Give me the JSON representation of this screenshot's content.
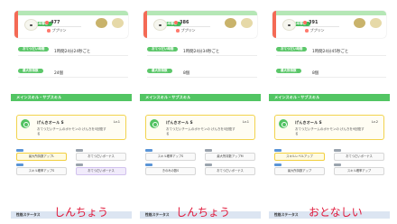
{
  "panels": [
    {
      "header_tag": "基本情報",
      "hp": "477",
      "owner": "ププリン",
      "rows": [
        {
          "label": "おてつだい時間",
          "value": "1時間24分24秒ごと"
        },
        {
          "label": "最大所持数",
          "value": "24個"
        }
      ],
      "section": "メインスキル・サブスキル",
      "skill_name": "げんきオール S",
      "skill_level": "Lv.1",
      "skill_desc": "おてつだいチームのポケモンの げんきを5回復する",
      "sub_skills": [
        {
          "label": "最大所持数アップL",
          "style": "gold",
          "chip": "blue"
        },
        {
          "label": "おてつだいボーナス",
          "style": "plain",
          "chip": "grey"
        },
        {
          "label": "スキル確率アップS",
          "style": "plain",
          "chip": "blue"
        },
        {
          "label": "おてつだいボーナス",
          "style": "lilac",
          "chip": "grey"
        }
      ],
      "footer": "性格ステータス",
      "caption": "しんちょう"
    },
    {
      "header_tag": "基本情報",
      "hp": "386",
      "owner": "ププリン",
      "rows": [
        {
          "label": "おてつだい時間",
          "value": "1時間24分34秒ごと"
        },
        {
          "label": "最大所持数",
          "value": "8個"
        }
      ],
      "section": "メインスキル・サブスキル",
      "skill_name": "げんきオール S",
      "skill_level": "Lv.1",
      "skill_desc": "おてつだいチームのポケモンの げんきを5回復する",
      "sub_skills": [
        {
          "label": "スキル確率アップS",
          "style": "plain",
          "chip": "blue"
        },
        {
          "label": "最大所持数アップM",
          "style": "plain",
          "chip": "grey"
        },
        {
          "label": "きのみの数S",
          "style": "plain",
          "chip": "blue"
        },
        {
          "label": "おてつだいボーナス",
          "style": "plain",
          "chip": "grey"
        }
      ],
      "footer": "性格ステータス",
      "caption": "しんちょう"
    },
    {
      "header_tag": "基本情報",
      "hp": "391",
      "owner": "ププリン",
      "rows": [
        {
          "label": "おてつだい時間",
          "value": "1時間24分45秒ごと"
        },
        {
          "label": "最大所持数",
          "value": "8個"
        }
      ],
      "section": "メインスキル・サブスキル",
      "skill_name": "げんきオール S",
      "skill_level": "Lv.2",
      "skill_desc": "おてつだいチームのポケモンの げんきを9回復する",
      "sub_skills": [
        {
          "label": "スキルレベルアップ",
          "style": "gold",
          "chip": "blue"
        },
        {
          "label": "おてつだいボーナス",
          "style": "plain",
          "chip": "grey"
        },
        {
          "label": "最大所持数アップ",
          "style": "plain",
          "chip": "blue"
        },
        {
          "label": "スキル確率アップ",
          "style": "plain",
          "chip": "grey"
        }
      ],
      "footer": "性格ステータス",
      "caption": "おとなしい"
    }
  ]
}
